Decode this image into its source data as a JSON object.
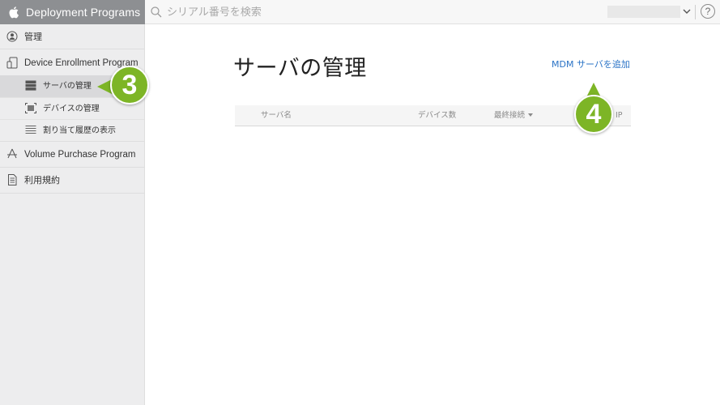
{
  "header": {
    "brand": "Deployment Programs",
    "search_placeholder": "シリアル番号を検索",
    "help_label": "?"
  },
  "sidebar": {
    "manage": "管理",
    "dep": {
      "label": "Device Enrollment Program",
      "items": [
        {
          "label": "サーバの管理",
          "active": true
        },
        {
          "label": "デバイスの管理",
          "active": false
        },
        {
          "label": "割り当て履歴の表示",
          "active": false
        }
      ]
    },
    "vpp": "Volume Purchase Program",
    "terms": "利用規約"
  },
  "main": {
    "title": "サーバの管理",
    "add_server": "MDM サーバを追加",
    "columns": {
      "name": "サーバ名",
      "device_count": "デバイス数",
      "last_connected": "最終接続",
      "ip": "IP"
    }
  },
  "callouts": {
    "step3": "3",
    "step4": "4"
  },
  "colors": {
    "brand_bar": "#8d8f92",
    "link": "#2a73c6",
    "callout": "#7db526"
  }
}
